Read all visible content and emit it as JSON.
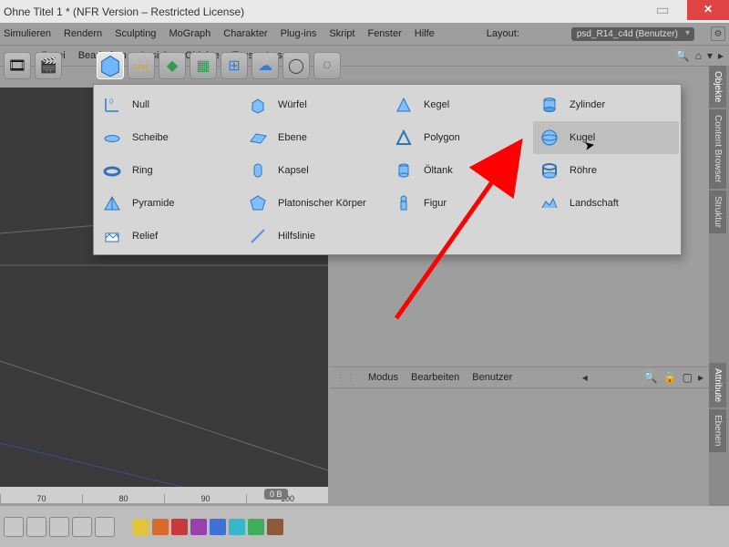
{
  "title": "Ohne Titel 1 * (NFR Version – Restricted License)",
  "menu": [
    "Simulieren",
    "Rendern",
    "Sculpting",
    "MoGraph",
    "Charakter",
    "Plug-ins",
    "Skript",
    "Fenster",
    "Hilfe"
  ],
  "layout_label": "Layout:",
  "layout_value": "psd_R14_c4d (Benutzer)",
  "submenu": [
    "Datei",
    "Bearbeiten",
    "Ansicht",
    "Objekte",
    "Tags",
    "Lese."
  ],
  "sidetabs": [
    "Objekte",
    "Content Browser",
    "Struktur",
    "Attribute",
    "Ebenen"
  ],
  "attrmenu": [
    "Modus",
    "Bearbeiten",
    "Benutzer"
  ],
  "ruler": [
    "70",
    "80",
    "90",
    "100"
  ],
  "mem": "0 B",
  "primitives": {
    "col1": [
      {
        "name": "null",
        "label": "Null"
      },
      {
        "name": "scheibe",
        "label": "Scheibe"
      },
      {
        "name": "ring",
        "label": "Ring"
      },
      {
        "name": "pyramide",
        "label": "Pyramide"
      },
      {
        "name": "relief",
        "label": "Relief"
      }
    ],
    "col2": [
      {
        "name": "wuerfel",
        "label": "Würfel"
      },
      {
        "name": "ebene",
        "label": "Ebene"
      },
      {
        "name": "kapsel",
        "label": "Kapsel"
      },
      {
        "name": "platon",
        "label": "Platonischer Körper"
      },
      {
        "name": "hilfslinie",
        "label": "Hilfslinie"
      }
    ],
    "col3": [
      {
        "name": "kegel",
        "label": "Kegel"
      },
      {
        "name": "polygon",
        "label": "Polygon"
      },
      {
        "name": "oeltank",
        "label": "Öltank"
      },
      {
        "name": "figur",
        "label": "Figur"
      }
    ],
    "col4": [
      {
        "name": "zylinder",
        "label": "Zylinder"
      },
      {
        "name": "kugel",
        "label": "Kugel"
      },
      {
        "name": "roehre",
        "label": "Röhre"
      },
      {
        "name": "landschaft",
        "label": "Landschaft"
      }
    ]
  },
  "highlighted_primitive": "kugel"
}
